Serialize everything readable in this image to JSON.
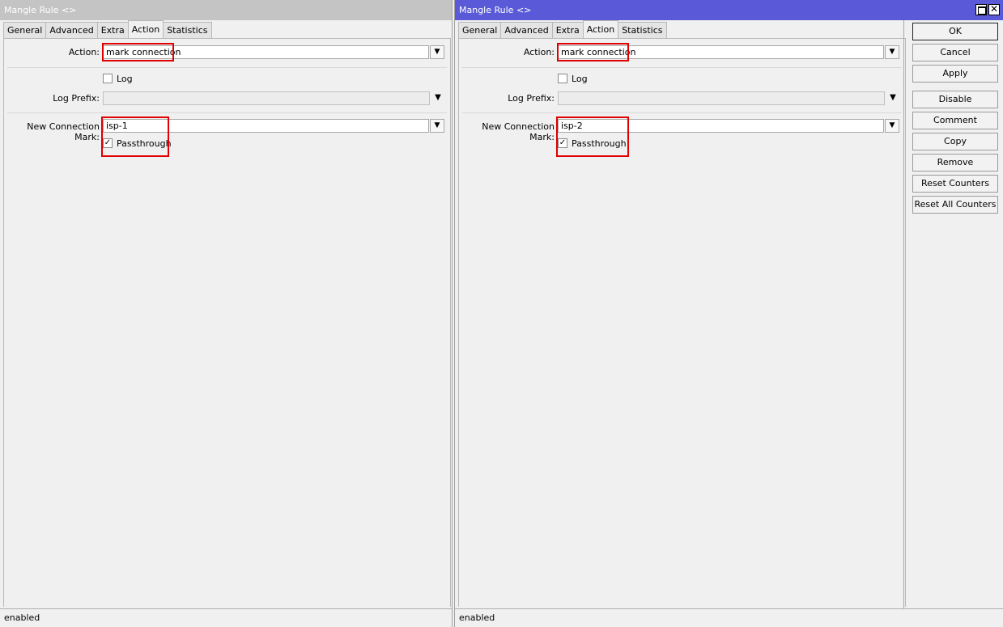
{
  "left_window": {
    "title": "Mangle Rule <>",
    "tabs": [
      "General",
      "Advanced",
      "Extra",
      "Action",
      "Statistics"
    ],
    "active_tab": "Action",
    "action_label": "Action:",
    "action_value": "mark connection",
    "log_label": "Log",
    "log_checked": false,
    "log_prefix_label": "Log Prefix:",
    "log_prefix_value": "",
    "new_conn_mark_label": "New Connection Mark:",
    "new_conn_mark_value": "isp-1",
    "passthrough_label": "Passthrough",
    "passthrough_checked": true,
    "status": "enabled"
  },
  "right_window": {
    "title": "Mangle Rule <>",
    "tabs": [
      "General",
      "Advanced",
      "Extra",
      "Action",
      "Statistics"
    ],
    "active_tab": "Action",
    "action_label": "Action:",
    "action_value": "mark connection",
    "log_label": "Log",
    "log_checked": false,
    "log_prefix_label": "Log Prefix:",
    "log_prefix_value": "",
    "new_conn_mark_label": "New Connection Mark:",
    "new_conn_mark_value": "isp-2",
    "passthrough_label": "Passthrough",
    "passthrough_checked": true,
    "status": "enabled",
    "buttons": {
      "ok": "OK",
      "cancel": "Cancel",
      "apply": "Apply",
      "disable": "Disable",
      "comment": "Comment",
      "copy": "Copy",
      "remove": "Remove",
      "reset_counters": "Reset Counters",
      "reset_all_counters": "Reset All Counters"
    }
  },
  "colors": {
    "active_titlebar": "#5a5ad8",
    "inactive_titlebar": "#c4c4c4",
    "highlight": "#e00000"
  }
}
